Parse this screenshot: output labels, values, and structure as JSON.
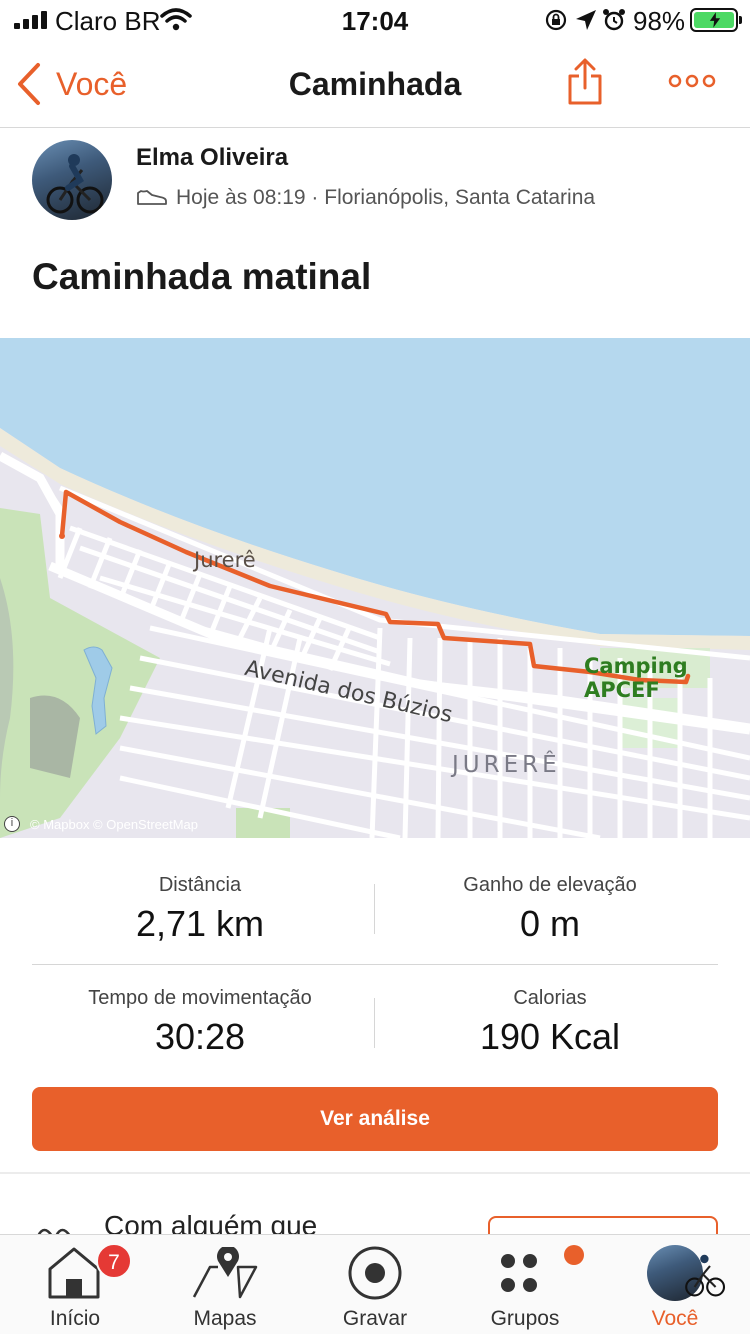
{
  "status_bar": {
    "carrier": "Claro BR",
    "time": "17:04",
    "battery": "98%"
  },
  "nav": {
    "back_label": "Você",
    "title": "Caminhada"
  },
  "activity": {
    "athlete": "Elma Oliveira",
    "meta": "Hoje às 08:19 · Florianópolis, Santa Catarina",
    "title": "Caminhada matinal"
  },
  "map": {
    "labels": {
      "jurere_top": "Jurerê",
      "camping": "Camping APCEF",
      "avenida": "Avenida dos Búzios",
      "jurere": "JURERÊ"
    },
    "attribution": "© Mapbox © OpenStreetMap",
    "info_glyph": "i",
    "colors": {
      "water": "#b5d8ee",
      "land": "#e8e6ee",
      "park": "#c9e3b8",
      "route": "#e8602b",
      "road": "#ffffff"
    }
  },
  "stats": {
    "distance": {
      "label": "Distância",
      "value": "2,71 km"
    },
    "elevation": {
      "label": "Ganho de elevação",
      "value": "0 m"
    },
    "moving_time": {
      "label": "Tempo de movimentação",
      "value": "30:28"
    },
    "calories": {
      "label": "Calorias",
      "value": "190 Kcal"
    }
  },
  "analysis_button": "Ver análise",
  "with_someone": "Com alguém que",
  "tabs": [
    {
      "label": "Início",
      "icon": "home-icon",
      "badge": "7"
    },
    {
      "label": "Mapas",
      "icon": "map-icon"
    },
    {
      "label": "Gravar",
      "icon": "record-icon"
    },
    {
      "label": "Grupos",
      "icon": "groups-icon"
    },
    {
      "label": "Você",
      "icon": "profile-avatar",
      "active": true
    }
  ],
  "colors": {
    "accent": "#e8602b",
    "badge": "#e53935"
  }
}
